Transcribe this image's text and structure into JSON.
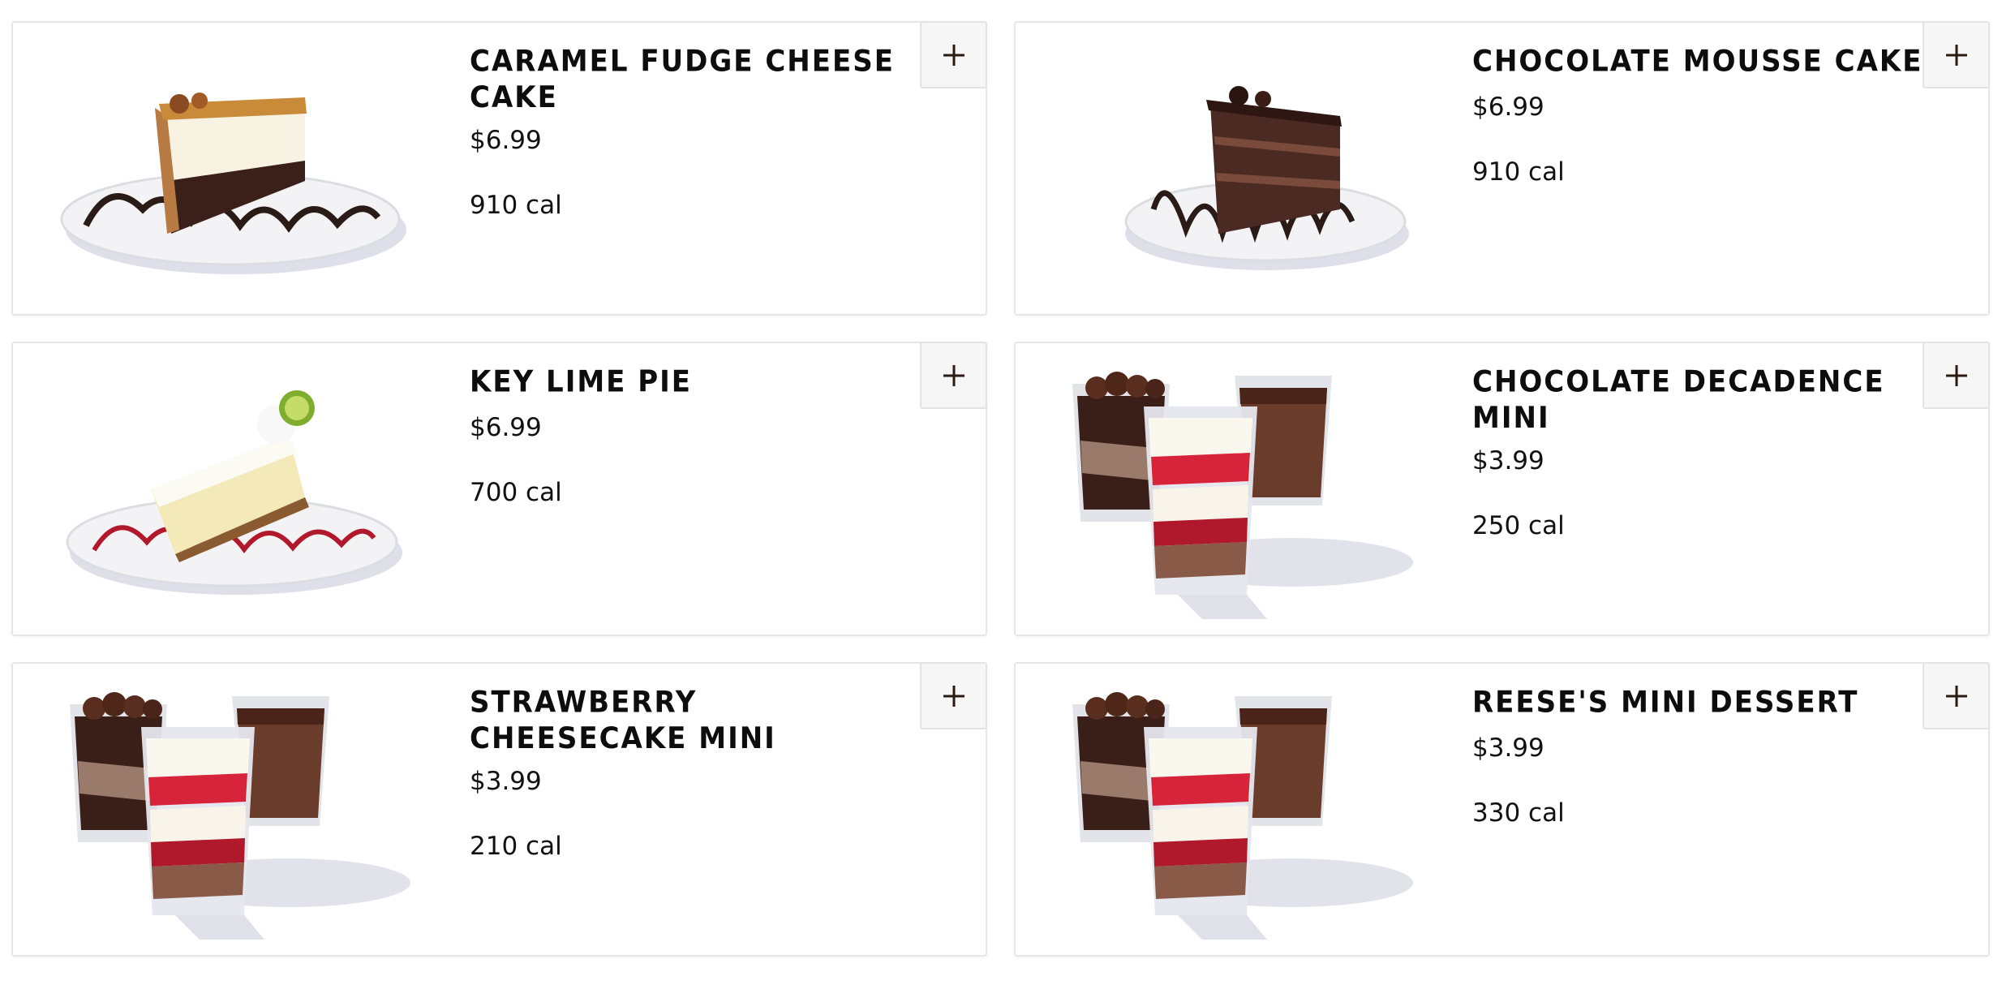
{
  "items": [
    {
      "name": "Caramel Fudge Cheese Cake",
      "price": "$6.99",
      "calories": "910 cal",
      "image": "cheesecake-slice-image"
    },
    {
      "name": "Chocolate Mousse Cake",
      "price": "$6.99",
      "calories": "910 cal",
      "image": "chocolate-cake-slice-image"
    },
    {
      "name": "Key Lime Pie",
      "price": "$6.99",
      "calories": "700 cal",
      "image": "key-lime-pie-slice-image"
    },
    {
      "name": "Chocolate Decadence Mini",
      "price": "$3.99",
      "calories": "250 cal",
      "image": "mini-dessert-cups-image"
    },
    {
      "name": "Strawberry Cheesecake Mini",
      "price": "$3.99",
      "calories": "210 cal",
      "image": "mini-dessert-cups-image"
    },
    {
      "name": "Reese's Mini Dessert",
      "price": "$3.99",
      "calories": "330 cal",
      "image": "mini-dessert-cups-image"
    }
  ],
  "add_icon": "plus-icon",
  "colors": {
    "accent": "#2a1a12",
    "card_border": "#e6e6e6",
    "button_bg": "#f6f6f6"
  }
}
